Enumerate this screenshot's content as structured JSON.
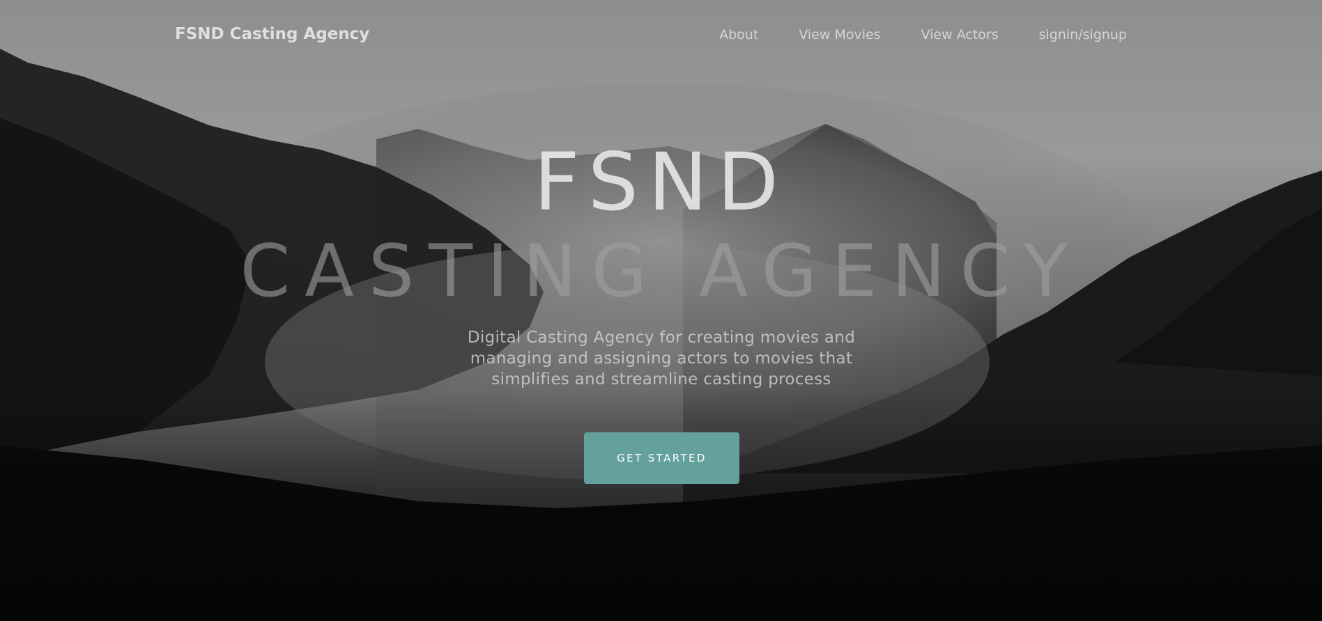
{
  "navbar": {
    "brand": "FSND Casting Agency",
    "links": [
      {
        "label": "About"
      },
      {
        "label": "View Movies"
      },
      {
        "label": "View Actors"
      },
      {
        "label": "signin/signup"
      }
    ]
  },
  "hero": {
    "title_line1": "FSND",
    "title_line2": "CASTING AGENCY",
    "subtitle": "Digital Casting Agency for creating movies and managing and assigning actors to movies that simplifies and streamline casting process",
    "cta_label": "GET STARTED"
  },
  "colors": {
    "accent": "#64a19d"
  }
}
